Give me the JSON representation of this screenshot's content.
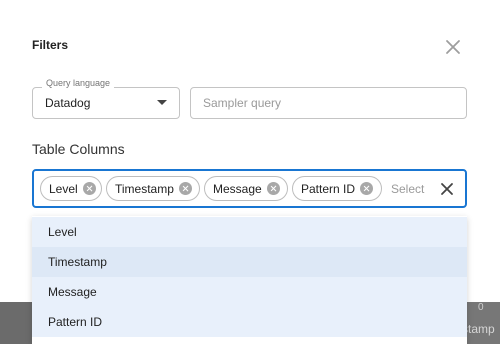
{
  "dialog": {
    "title": "Filters"
  },
  "query_language": {
    "label": "Query language",
    "value": "Datadog"
  },
  "sampler_query": {
    "placeholder": "Sampler query",
    "value": ""
  },
  "table_columns": {
    "label": "Table Columns",
    "chips": [
      "Level",
      "Timestamp",
      "Message",
      "Pattern ID"
    ],
    "placeholder": "Select",
    "options": [
      "Level",
      "Timestamp",
      "Message",
      "Pattern ID"
    ]
  },
  "background": {
    "peek_text": "stamp",
    "peek_hint": "0"
  },
  "colors": {
    "accent": "#1976d2",
    "option_selected": "#e8f0fb"
  }
}
